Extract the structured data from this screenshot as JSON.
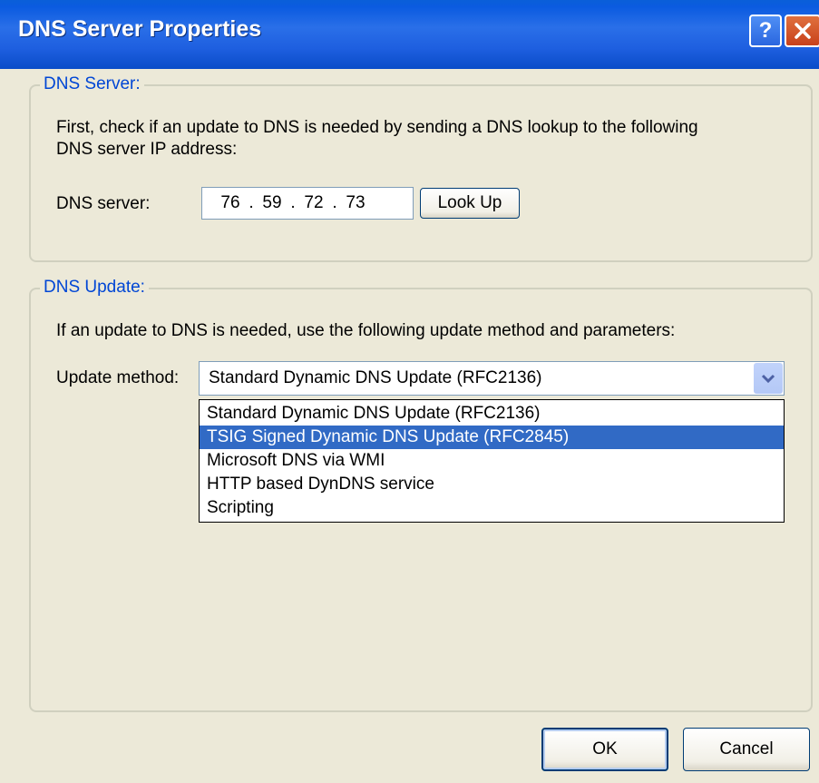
{
  "window": {
    "title": "DNS Server Properties"
  },
  "titlebar": {
    "help_label": "?",
    "close_icon": "close-icon"
  },
  "dns_server_group": {
    "legend": "DNS Server:",
    "description_line1": "First, check if an update to DNS is needed by sending a DNS lookup to the following",
    "description_line2": "DNS server IP address:",
    "server_label": "DNS server:",
    "ip": [
      "76",
      "59",
      "72",
      "73"
    ],
    "lookup_button": "Look Up"
  },
  "dns_update_group": {
    "legend": "DNS Update:",
    "description": "If an update to DNS is needed, use the following update method and parameters:",
    "method_label": "Update method:",
    "selected_method": "Standard Dynamic DNS Update (RFC2136)",
    "options": [
      "Standard Dynamic DNS Update (RFC2136)",
      "TSIG Signed Dynamic DNS Update (RFC2845)",
      "Microsoft DNS via WMI",
      "HTTP based DynDNS service",
      "Scripting"
    ],
    "highlighted_option_index": 1
  },
  "footer": {
    "ok_label": "OK",
    "cancel_label": "Cancel"
  },
  "colors": {
    "title_bar": "#0b5be0",
    "legend_text": "#0046d5",
    "highlight": "#316ac5",
    "background": "#ece9d8"
  }
}
